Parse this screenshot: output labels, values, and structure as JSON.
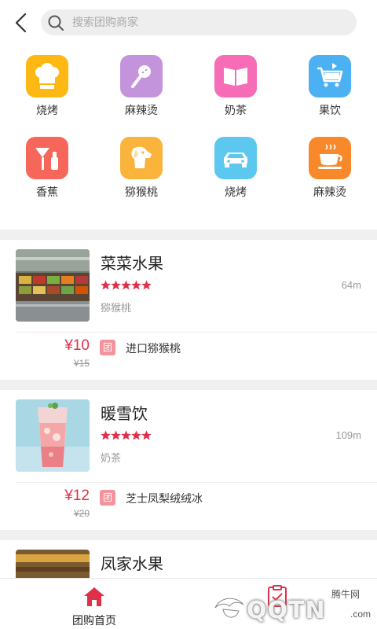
{
  "header": {
    "back_icon": "chevron-left-icon",
    "search_placeholder": "搜索团购商家",
    "search_icon": "search-icon"
  },
  "categories": [
    {
      "label": "烧烤",
      "icon": "chef-hat-icon",
      "color": "#FDB813"
    },
    {
      "label": "麻辣烫",
      "icon": "microphone-icon",
      "color": "#C394DC"
    },
    {
      "label": "奶茶",
      "icon": "book-icon",
      "color": "#F76CB7"
    },
    {
      "label": "果饮",
      "icon": "shopping-cart-icon",
      "color": "#4CB1F2"
    },
    {
      "label": "香蕉",
      "icon": "cosmetics-icon",
      "color": "#F6665A"
    },
    {
      "label": "猕猴桃",
      "icon": "dog-icon",
      "color": "#FAB43C"
    },
    {
      "label": "烧烤",
      "icon": "car-icon",
      "color": "#5DC8EF"
    },
    {
      "label": "麻辣烫",
      "icon": "coffee-cup-icon",
      "color": "#F7892B"
    }
  ],
  "stores": [
    {
      "name": "菜菜水果",
      "rating": 5,
      "distance": "64m",
      "category": "猕猴桃",
      "price": "¥10",
      "original_price": "¥15",
      "tag": "团",
      "deal": "进口猕猴桃",
      "thumb": "fruit-stall"
    },
    {
      "name": "暖雪饮",
      "rating": 5,
      "distance": "109m",
      "category": "奶茶",
      "price": "¥12",
      "original_price": "¥20",
      "tag": "团",
      "deal": "芝士凤梨绒绒冰",
      "thumb": "drink"
    },
    {
      "name": "凤家水果",
      "thumb": "fruit-shop"
    }
  ],
  "nav": {
    "home_label": "团购首页",
    "home_icon": "home-icon",
    "orders_icon": "order-list-icon"
  },
  "watermark": {
    "top": "腾牛网",
    "brand": "QQTN",
    "domain": ".com"
  },
  "colors": {
    "accent": "#E0314A",
    "star": "#E0314A",
    "tag_bg": "#F3939C"
  }
}
